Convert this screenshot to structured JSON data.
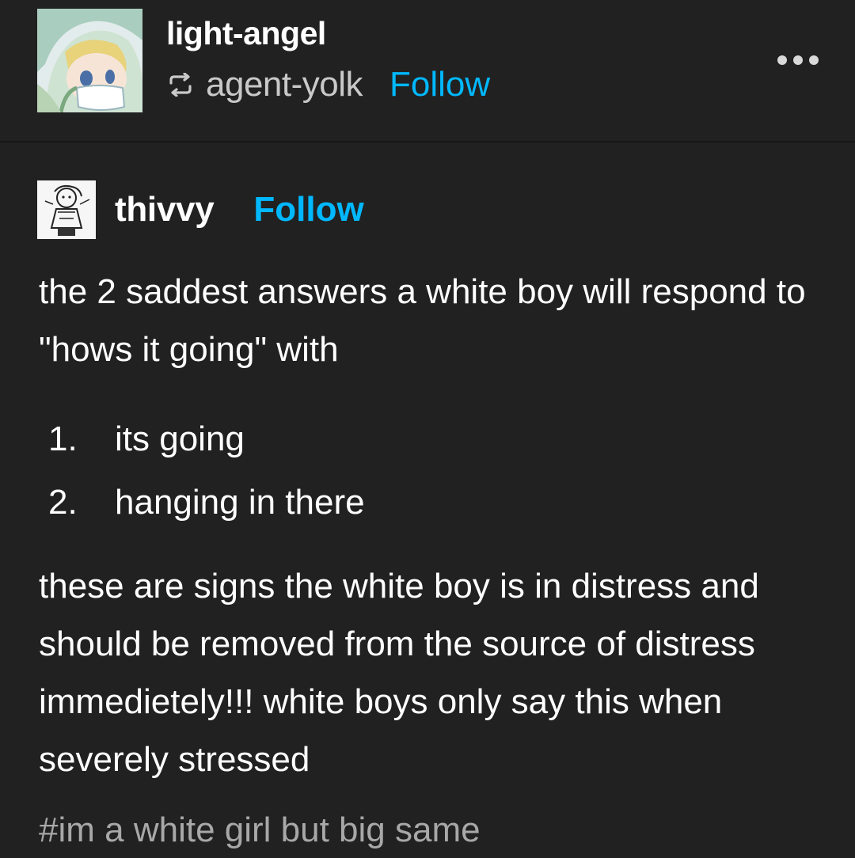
{
  "header": {
    "poster_name": "light-angel",
    "reblogged_from": "agent-yolk",
    "follow_label": "Follow",
    "more_icon": "more-dots-icon",
    "reblog_icon": "reblog-icon"
  },
  "original_post": {
    "author": "thivvy",
    "follow_label": "Follow",
    "paragraph1": "the 2 saddest answers a white boy will respond to \"hows it going\" with",
    "list": [
      {
        "num": "1.",
        "text": "its going"
      },
      {
        "num": "2.",
        "text": "hanging in there"
      }
    ],
    "paragraph2": "these are signs the white boy is in distress and should be removed from the source of distress immedietely!!! white boys only say this when severely stressed"
  },
  "tags": {
    "text": "#im a white girl but big same"
  },
  "colors": {
    "background": "#212121",
    "accent": "#00b8ff",
    "secondary_text": "#c9c9c9",
    "tag_text": "#a8a8a8"
  }
}
